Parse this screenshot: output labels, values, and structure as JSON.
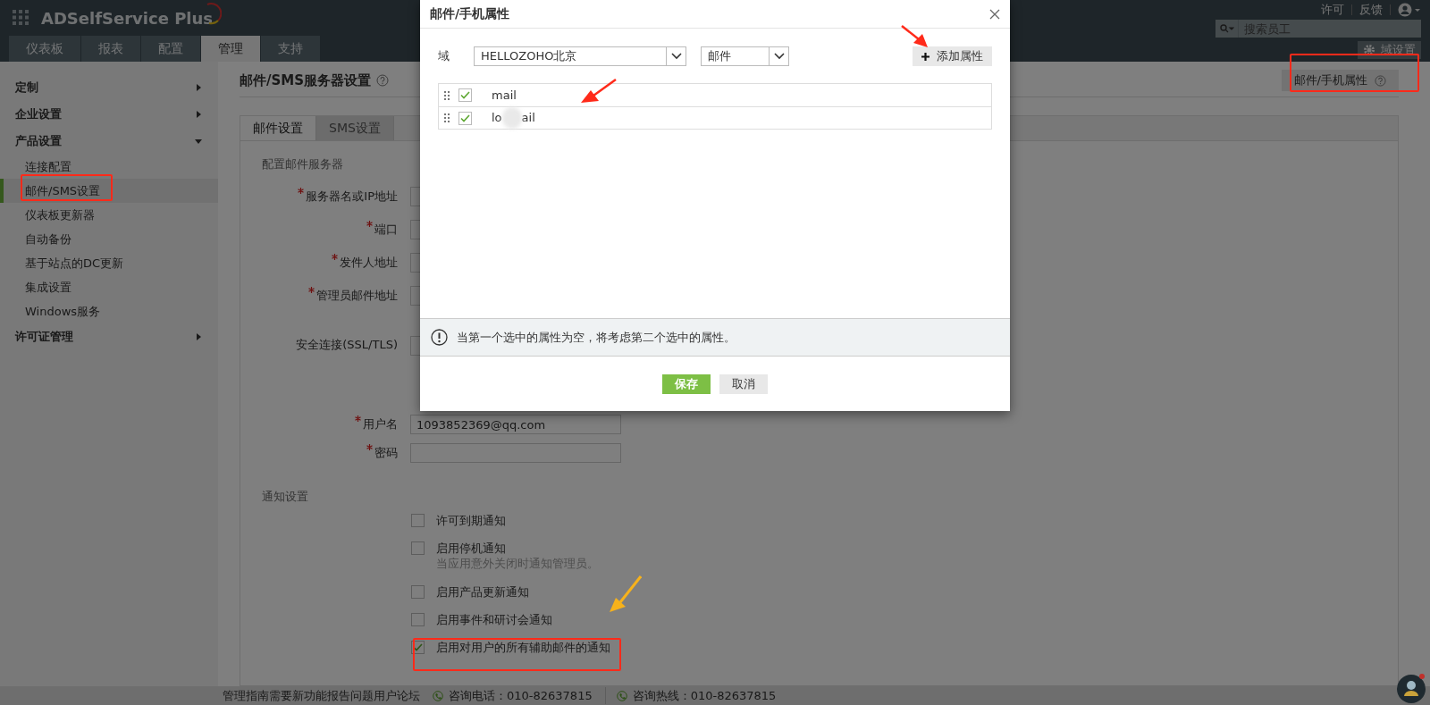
{
  "app": {
    "name": "ADSelfService Plus",
    "top_links": [
      "许可",
      "反馈"
    ],
    "search": {
      "placeholder": "搜索员工"
    },
    "domain_button": "域设置"
  },
  "tabs": [
    {
      "label": "仪表板",
      "selected": false
    },
    {
      "label": "报表",
      "selected": false
    },
    {
      "label": "配置",
      "selected": false
    },
    {
      "label": "管理",
      "selected": true
    },
    {
      "label": "支持",
      "selected": false
    }
  ],
  "sidebar": [
    {
      "label": "定制",
      "expanded": false
    },
    {
      "label": "企业设置",
      "expanded": false
    },
    {
      "label": "产品设置",
      "expanded": true,
      "children": [
        {
          "label": "连接配置",
          "selected": false
        },
        {
          "label": "邮件/SMS设置",
          "selected": true
        },
        {
          "label": "仪表板更新器",
          "selected": false
        },
        {
          "label": "自动备份",
          "selected": false
        },
        {
          "label": "基于站点的DC更新",
          "selected": false
        },
        {
          "label": "集成设置",
          "selected": false
        },
        {
          "label": "Windows服务",
          "selected": false
        }
      ]
    },
    {
      "label": "许可证管理",
      "expanded": false
    }
  ],
  "page": {
    "title": "邮件/SMS服务器设置",
    "attribute_button": "邮件/手机属性",
    "tabs": [
      {
        "label": "邮件设置",
        "selected": true
      },
      {
        "label": "SMS设置",
        "selected": false
      }
    ],
    "section_title": "配置邮件服务器",
    "fields": [
      {
        "label": "服务器名或IP地址",
        "required": true
      },
      {
        "label": "端口",
        "required": true
      },
      {
        "label": "发件人地址",
        "required": true
      },
      {
        "label": "管理员邮件地址",
        "required": true
      },
      {
        "label": "安全连接(SSL/TLS)",
        "required": false
      },
      {
        "label": "用户名",
        "required": true,
        "value": "1093852369@qq.com"
      },
      {
        "label": "密码",
        "required": true
      }
    ],
    "notifications_title": "通知设置",
    "notifications": [
      {
        "label": "许可到期通知",
        "checked": false
      },
      {
        "label": "启用停机通知",
        "checked": false,
        "hint": "当应用意外关闭时通知管理员。"
      },
      {
        "label": "启用产品更新通知",
        "checked": false
      },
      {
        "label": "启用事件和研讨会通知",
        "checked": false
      },
      {
        "label": "启用对用户的所有辅助邮件的通知",
        "checked": true
      }
    ]
  },
  "footer": {
    "links": [
      "管理指南",
      "需要新功能",
      "报告问题",
      "用户论坛"
    ],
    "contacts": [
      "咨询电话：010-82637815",
      "咨询热线：010-82637815"
    ]
  },
  "dialog": {
    "title": "邮件/手机属性",
    "domain_label": "域",
    "domain": "HELLOZOHO北京",
    "type": "邮件",
    "add_button": "添加属性",
    "attributes": [
      {
        "text": "mail",
        "checked": true
      },
      {
        "text": "lo",
        "masked": true,
        "text_after": "ail",
        "checked": true
      }
    ],
    "notice": "当第一个选中的属性为空，将考虑第二个选中的属性。",
    "save": "保存",
    "cancel": "取消"
  }
}
